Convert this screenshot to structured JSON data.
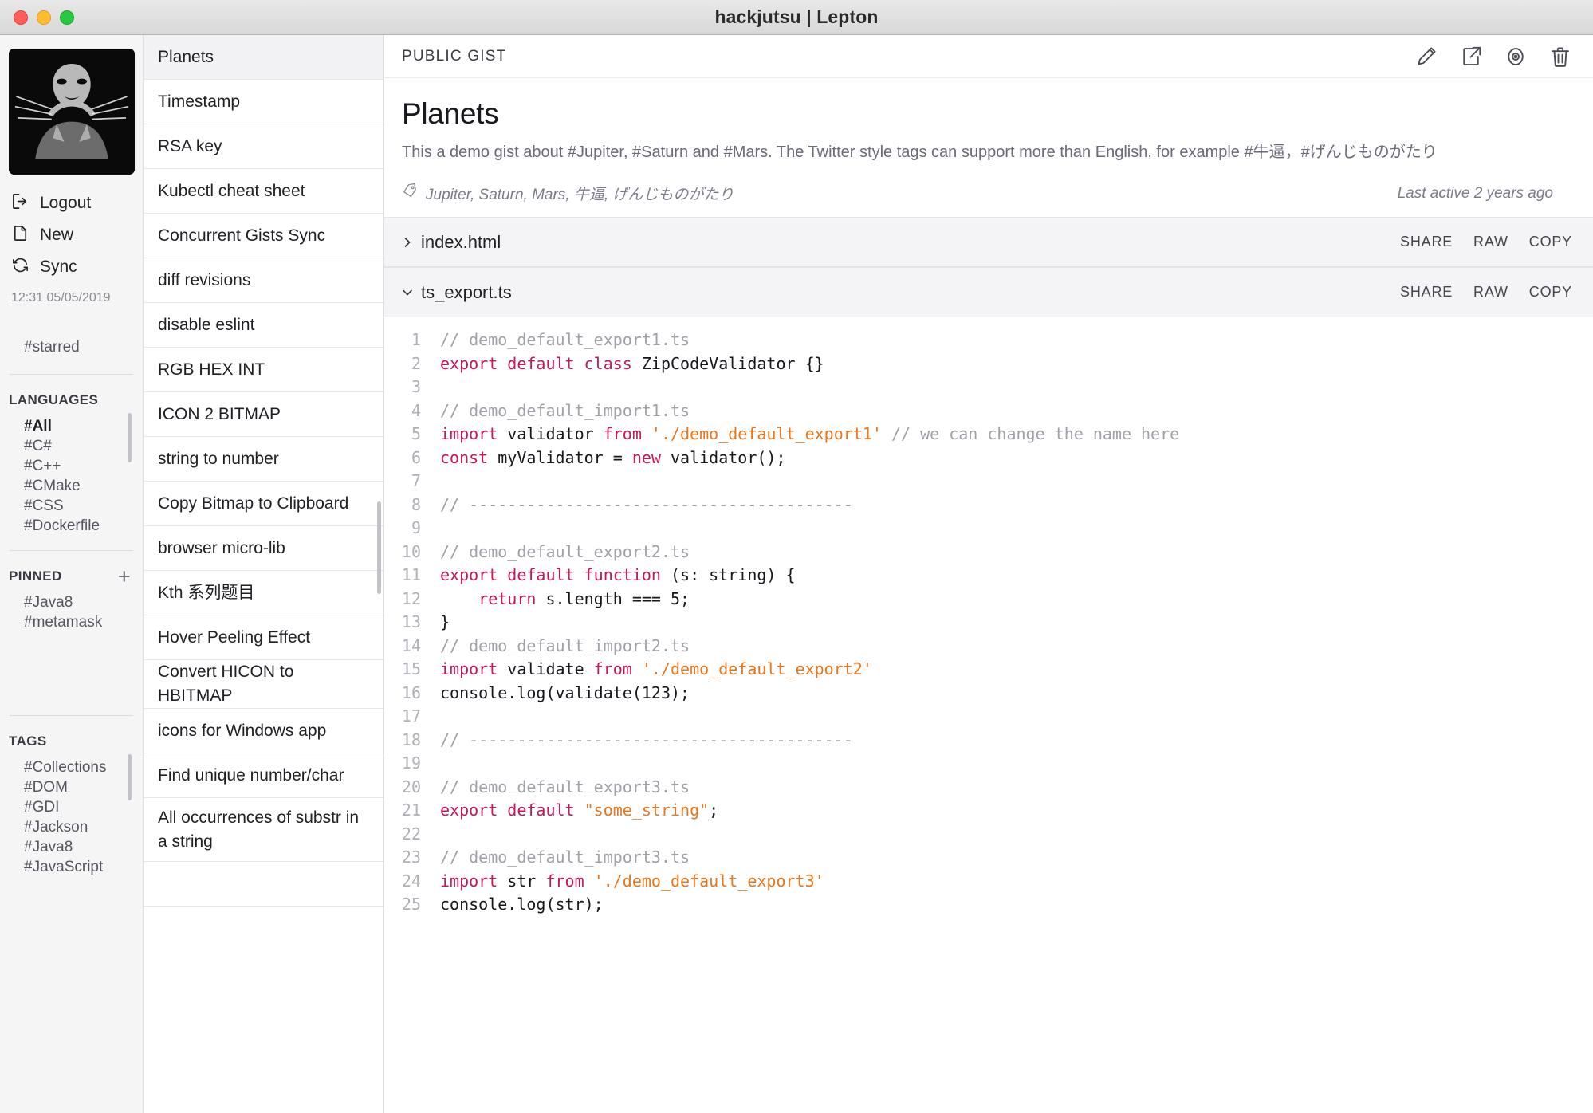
{
  "window": {
    "title": "hackjutsu | Lepton",
    "traffic_lights": [
      "close",
      "minimize",
      "maximize"
    ]
  },
  "sidebar": {
    "avatar_alt": "wolverine-avatar",
    "actions": [
      {
        "icon": "logout-icon",
        "label": "Logout"
      },
      {
        "icon": "new-file-icon",
        "label": "New"
      },
      {
        "icon": "sync-icon",
        "label": "Sync"
      }
    ],
    "sync_time": "12:31 05/05/2019",
    "starred": "#starred",
    "languages": {
      "header": "LANGUAGES",
      "items": [
        "#All",
        "#C#",
        "#C++",
        "#CMake",
        "#CSS",
        "#Dockerfile"
      ],
      "active": "#All"
    },
    "pinned": {
      "header": "PINNED",
      "add_label": "+",
      "items": [
        "#Java8",
        "#metamask"
      ]
    },
    "tags": {
      "header": "TAGS",
      "items": [
        "#Collections",
        "#DOM",
        "#GDI",
        "#Jackson",
        "#Java8",
        "#JavaScript"
      ]
    }
  },
  "gist_list": {
    "selected": "Planets",
    "items": [
      "Planets",
      "Timestamp",
      "RSA key",
      "Kubectl cheat sheet",
      "Concurrent Gists Sync",
      "diff revisions",
      "disable eslint",
      "RGB HEX INT",
      "ICON 2 BITMAP",
      "string to number",
      "Copy Bitmap to Clipboard",
      "browser micro-lib",
      "Kth 系列题目",
      "Hover Peeling Effect",
      "Convert HICON to HBITMAP",
      "icons for Windows app",
      "Find unique number/char",
      "All occurrences of substr in a string"
    ]
  },
  "main": {
    "visibility_label": "PUBLIC GIST",
    "toolbar_icons": [
      "edit-pencil-icon",
      "external-link-icon",
      "eye-icon",
      "trash-icon"
    ],
    "title": "Planets",
    "description": "This a demo gist about #Jupiter, #Saturn and #Mars. The Twitter style tags can support more than English, for example #牛逼，#げんじものがたり",
    "tags_line": "Jupiter, Saturn, Mars, 牛逼, げんじものがたり",
    "last_active": "Last active 2 years ago",
    "files": [
      {
        "name": "index.html",
        "expanded": false,
        "chevron": "chevron-right-icon",
        "actions": [
          "SHARE",
          "RAW",
          "COPY"
        ]
      },
      {
        "name": "ts_export.ts",
        "expanded": true,
        "chevron": "chevron-down-icon",
        "actions": [
          "SHARE",
          "RAW",
          "COPY"
        ]
      }
    ],
    "code": {
      "language": "typescript",
      "lines": [
        {
          "n": 1,
          "tokens": [
            {
              "t": "// demo_default_export1.ts",
              "c": "cm"
            }
          ]
        },
        {
          "n": 2,
          "tokens": [
            {
              "t": "export default class",
              "c": "kw"
            },
            {
              "t": " ZipCodeValidator {}",
              "c": ""
            }
          ]
        },
        {
          "n": 3,
          "tokens": []
        },
        {
          "n": 4,
          "tokens": [
            {
              "t": "// demo_default_import1.ts",
              "c": "cm"
            }
          ]
        },
        {
          "n": 5,
          "tokens": [
            {
              "t": "import",
              "c": "kw"
            },
            {
              "t": " validator ",
              "c": ""
            },
            {
              "t": "from",
              "c": "kw"
            },
            {
              "t": " ",
              "c": ""
            },
            {
              "t": "'./demo_default_export1'",
              "c": "str"
            },
            {
              "t": " ",
              "c": ""
            },
            {
              "t": "// we can change the name here",
              "c": "cm"
            }
          ]
        },
        {
          "n": 6,
          "tokens": [
            {
              "t": "const",
              "c": "kw"
            },
            {
              "t": " myValidator = ",
              "c": ""
            },
            {
              "t": "new",
              "c": "kw"
            },
            {
              "t": " validator();",
              "c": ""
            }
          ]
        },
        {
          "n": 7,
          "tokens": []
        },
        {
          "n": 8,
          "tokens": [
            {
              "t": "// ----------------------------------------",
              "c": "cm"
            }
          ]
        },
        {
          "n": 9,
          "tokens": []
        },
        {
          "n": 10,
          "tokens": [
            {
              "t": "// demo_default_export2.ts",
              "c": "cm"
            }
          ]
        },
        {
          "n": 11,
          "tokens": [
            {
              "t": "export default function",
              "c": "kw"
            },
            {
              "t": " (s: string) {",
              "c": ""
            }
          ]
        },
        {
          "n": 12,
          "tokens": [
            {
              "t": "    ",
              "c": ""
            },
            {
              "t": "return",
              "c": "kw"
            },
            {
              "t": " s.length === 5;",
              "c": ""
            }
          ]
        },
        {
          "n": 13,
          "tokens": [
            {
              "t": "}",
              "c": ""
            }
          ]
        },
        {
          "n": 14,
          "tokens": [
            {
              "t": "// demo_default_import2.ts",
              "c": "cm"
            }
          ]
        },
        {
          "n": 15,
          "tokens": [
            {
              "t": "import",
              "c": "kw"
            },
            {
              "t": " validate ",
              "c": ""
            },
            {
              "t": "from",
              "c": "kw"
            },
            {
              "t": " ",
              "c": ""
            },
            {
              "t": "'./demo_default_export2'",
              "c": "str"
            }
          ]
        },
        {
          "n": 16,
          "tokens": [
            {
              "t": "console.log(validate(123);",
              "c": ""
            }
          ]
        },
        {
          "n": 17,
          "tokens": []
        },
        {
          "n": 18,
          "tokens": [
            {
              "t": "// ----------------------------------------",
              "c": "cm"
            }
          ]
        },
        {
          "n": 19,
          "tokens": []
        },
        {
          "n": 20,
          "tokens": [
            {
              "t": "// demo_default_export3.ts",
              "c": "cm"
            }
          ]
        },
        {
          "n": 21,
          "tokens": [
            {
              "t": "export default",
              "c": "kw"
            },
            {
              "t": " ",
              "c": ""
            },
            {
              "t": "\"some_string\"",
              "c": "str"
            },
            {
              "t": ";",
              "c": ""
            }
          ]
        },
        {
          "n": 22,
          "tokens": []
        },
        {
          "n": 23,
          "tokens": [
            {
              "t": "// demo_default_import3.ts",
              "c": "cm"
            }
          ]
        },
        {
          "n": 24,
          "tokens": [
            {
              "t": "import",
              "c": "kw"
            },
            {
              "t": " str ",
              "c": ""
            },
            {
              "t": "from",
              "c": "kw"
            },
            {
              "t": " ",
              "c": ""
            },
            {
              "t": "'./demo_default_export3'",
              "c": "str"
            }
          ]
        },
        {
          "n": 25,
          "tokens": [
            {
              "t": "console.log(str);",
              "c": ""
            }
          ]
        }
      ]
    }
  },
  "colors": {
    "keyword": "#c2185b",
    "string": "#e8761d",
    "comment": "#a0a0a8",
    "sidebar_bg": "#f5f5f5",
    "selected_row": "#f2f2f4"
  }
}
